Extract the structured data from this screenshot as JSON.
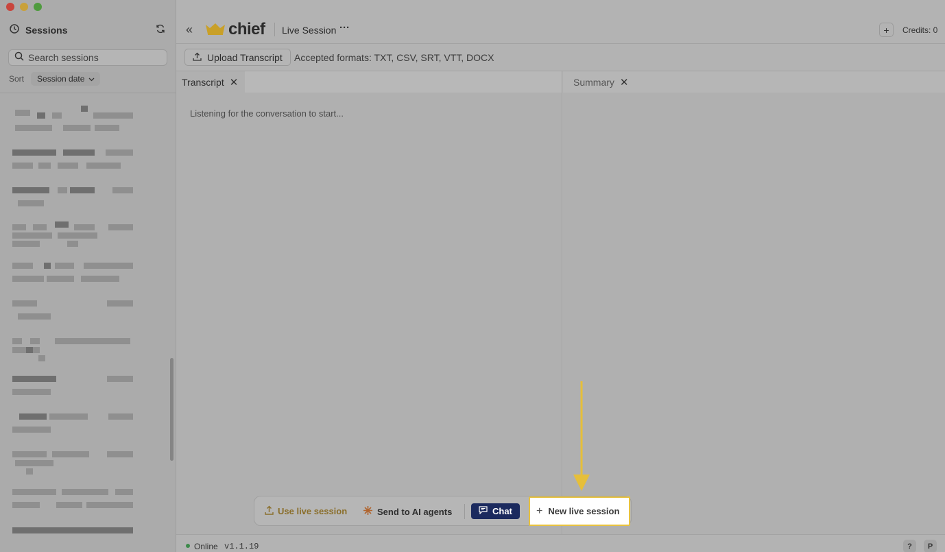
{
  "sidebar": {
    "title": "Sessions",
    "search_placeholder": "Search sessions",
    "sort_label": "Sort",
    "sort_value": "Session date"
  },
  "topbar": {
    "brand": "chief",
    "page_title": "Live Session",
    "more": "···",
    "add": "+",
    "credits": "Credits: 0"
  },
  "upload": {
    "button_label": "Upload Transcript",
    "formats": "Accepted formats: TXT, CSV, SRT, VTT, DOCX"
  },
  "panes": {
    "transcript_tab": "Transcript",
    "summary_tab": "Summary",
    "listening": "Listening for the conversation to start..."
  },
  "actions": {
    "use_live": "Use live session",
    "send_agents": "Send to AI agents",
    "chat": "Chat",
    "new_live": "New live session"
  },
  "status": {
    "state": "Online",
    "version": "v1.1.19",
    "help": "?",
    "profile": "P"
  },
  "colors": {
    "accent_chat": "#1b2a5e",
    "highlight": "#e8c23e",
    "brand_gold": "#c9a028"
  }
}
